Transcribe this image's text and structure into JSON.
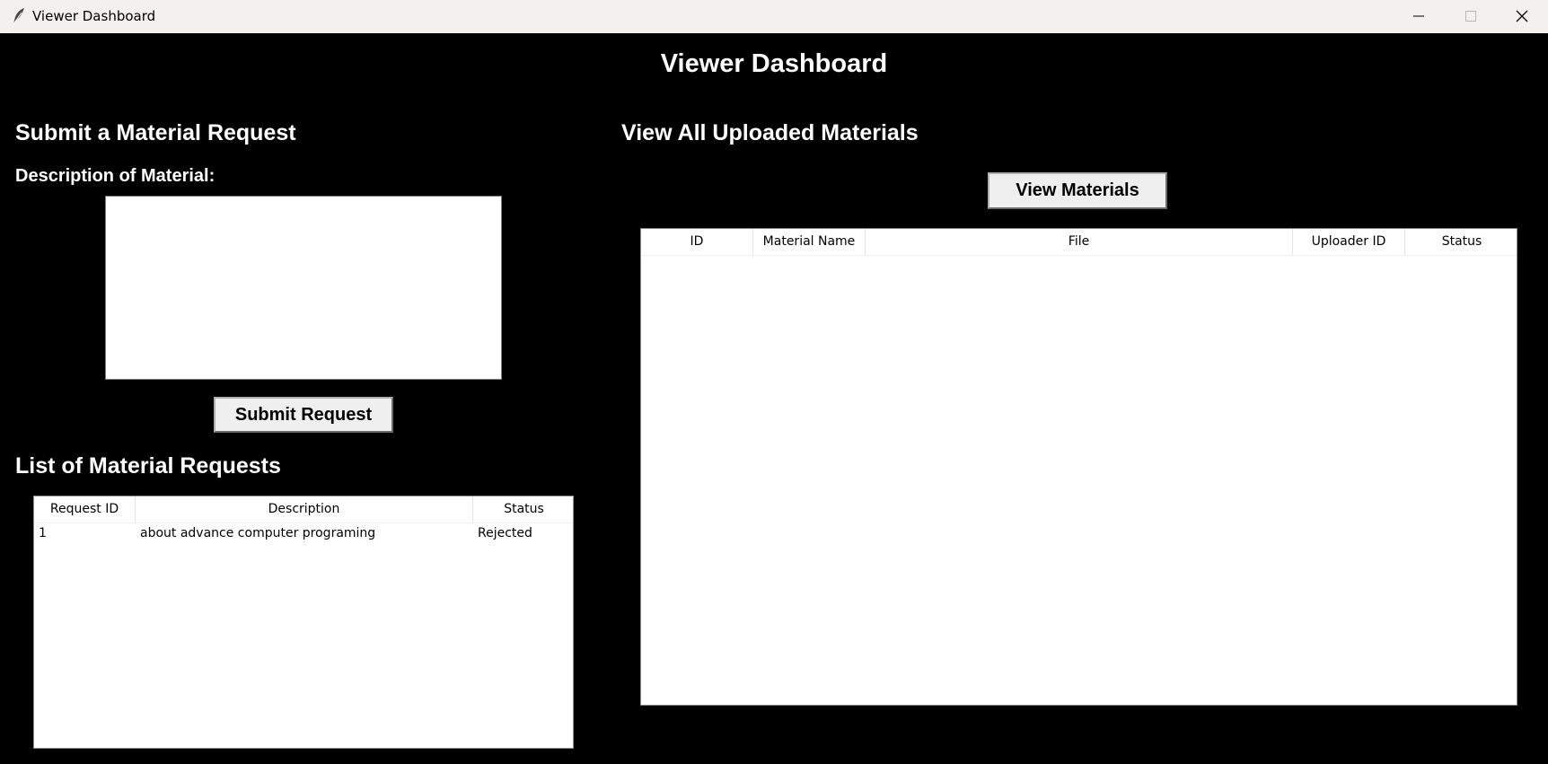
{
  "window": {
    "title": "Viewer Dashboard",
    "icon": "feather-icon",
    "controls": [
      "minimize-icon",
      "maximize-icon",
      "close-icon"
    ]
  },
  "page_title": "Viewer Dashboard",
  "request_form": {
    "heading": "Submit a Material Request",
    "description_label": "Description of Material:",
    "description_value": "",
    "submit_label": "Submit Request"
  },
  "requests_list": {
    "heading": "List of Material Requests",
    "columns": [
      "Request ID",
      "Description",
      "Status"
    ],
    "rows": [
      {
        "id": "1",
        "description": "about advance computer programing",
        "status": "Rejected"
      }
    ]
  },
  "materials": {
    "heading": "View All Uploaded Materials",
    "view_label": "View Materials",
    "columns": [
      "ID",
      "Material Name",
      "File",
      "Uploader ID",
      "Status"
    ],
    "rows": []
  }
}
